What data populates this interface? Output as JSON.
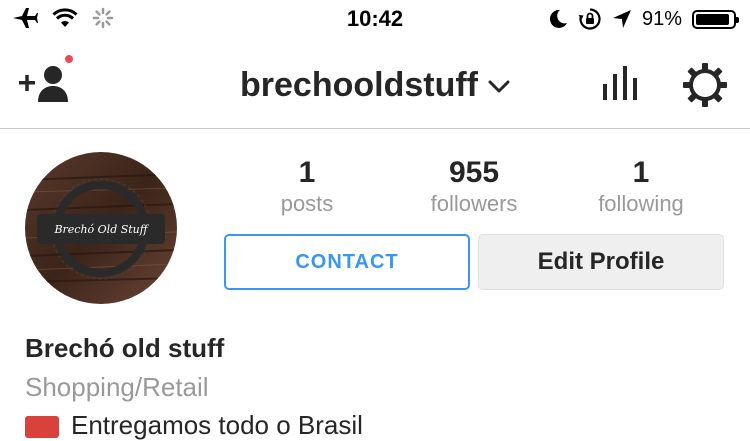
{
  "status_bar": {
    "time": "10:42",
    "battery_percent": "91%",
    "battery_level": 0.91,
    "icons": [
      "airplane-icon",
      "wifi-icon",
      "activity-spinner-icon",
      "moon-icon",
      "rotation-lock-icon",
      "location-arrow-icon",
      "battery-icon"
    ]
  },
  "nav": {
    "username": "brechooldstuff",
    "icons": [
      "add-user-icon",
      "chevron-down-icon",
      "insights-icon",
      "settings-icon"
    ],
    "notification_color": "#ed4956"
  },
  "profile": {
    "avatar_text": "Brechó Old Stuff",
    "stats": [
      {
        "value": "1",
        "label": "posts"
      },
      {
        "value": "955",
        "label": "followers"
      },
      {
        "value": "1",
        "label": "following"
      }
    ],
    "contact_label": "CONTACT",
    "edit_label": "Edit Profile",
    "name": "Brechó old stuff",
    "category": "Shopping/Retail",
    "bio_partial": "Entregamos todo o Brasil"
  },
  "colors": {
    "accent": "#3897f0",
    "secondary_text": "#999999"
  }
}
